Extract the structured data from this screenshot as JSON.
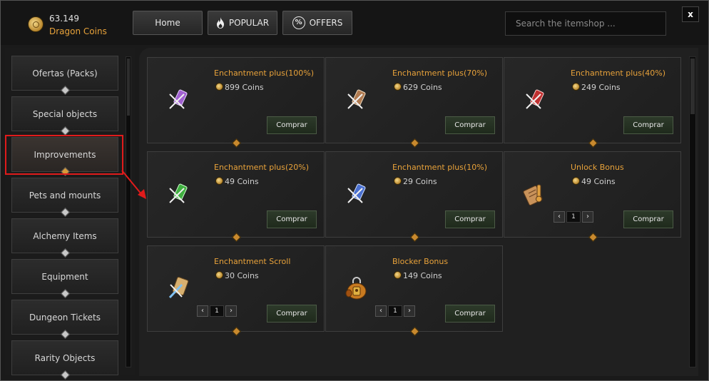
{
  "header": {
    "coins_amount": "63.149",
    "coins_name": "Dragon Coins",
    "nav": {
      "home": "Home",
      "popular": "POPULAR",
      "offers": "OFFERS"
    },
    "search_placeholder": "Search the itemshop ...",
    "close_label": "x"
  },
  "sidebar": {
    "items": [
      {
        "label": "Ofertas (Packs)"
      },
      {
        "label": "Special objects"
      },
      {
        "label": "Improvements"
      },
      {
        "label": "Pets and mounts"
      },
      {
        "label": "Alchemy Items"
      },
      {
        "label": "Equipment"
      },
      {
        "label": "Dungeon Tickets"
      },
      {
        "label": "Rarity Objects"
      }
    ],
    "active_index": 2
  },
  "products": [
    {
      "title": "Enchantment plus(100%)",
      "price": "899 Coins",
      "buy": "Comprar",
      "icon": "purple-enchant-scroll-icon",
      "color": "#a060d0"
    },
    {
      "title": "Enchantment plus(70%)",
      "price": "629 Coins",
      "buy": "Comprar",
      "icon": "brown-enchant-scroll-icon",
      "color": "#b07a50"
    },
    {
      "title": "Enchantment plus(40%)",
      "price": "249 Coins",
      "buy": "Comprar",
      "icon": "red-enchant-scroll-icon",
      "color": "#c03030"
    },
    {
      "title": "Enchantment plus(20%)",
      "price": "49 Coins",
      "buy": "Comprar",
      "icon": "green-enchant-scroll-icon",
      "color": "#40b040"
    },
    {
      "title": "Enchantment plus(10%)",
      "price": "29 Coins",
      "buy": "Comprar",
      "icon": "blue-enchant-scroll-icon",
      "color": "#4a70d0"
    },
    {
      "title": "Unlock Bonus",
      "price": "49 Coins",
      "buy": "Comprar",
      "icon": "unlock-scroll-icon",
      "color": "#c8925a",
      "qty": "1"
    },
    {
      "title": "Enchantment Scroll",
      "price": "30 Coins",
      "buy": "Comprar",
      "icon": "enchant-scroll-icon",
      "color": "#d8b070",
      "qty": "1"
    },
    {
      "title": "Blocker Bonus",
      "price": "149 Coins",
      "buy": "Comprar",
      "icon": "lock-bag-icon",
      "color": "#c87a20",
      "qty": "1"
    }
  ]
}
